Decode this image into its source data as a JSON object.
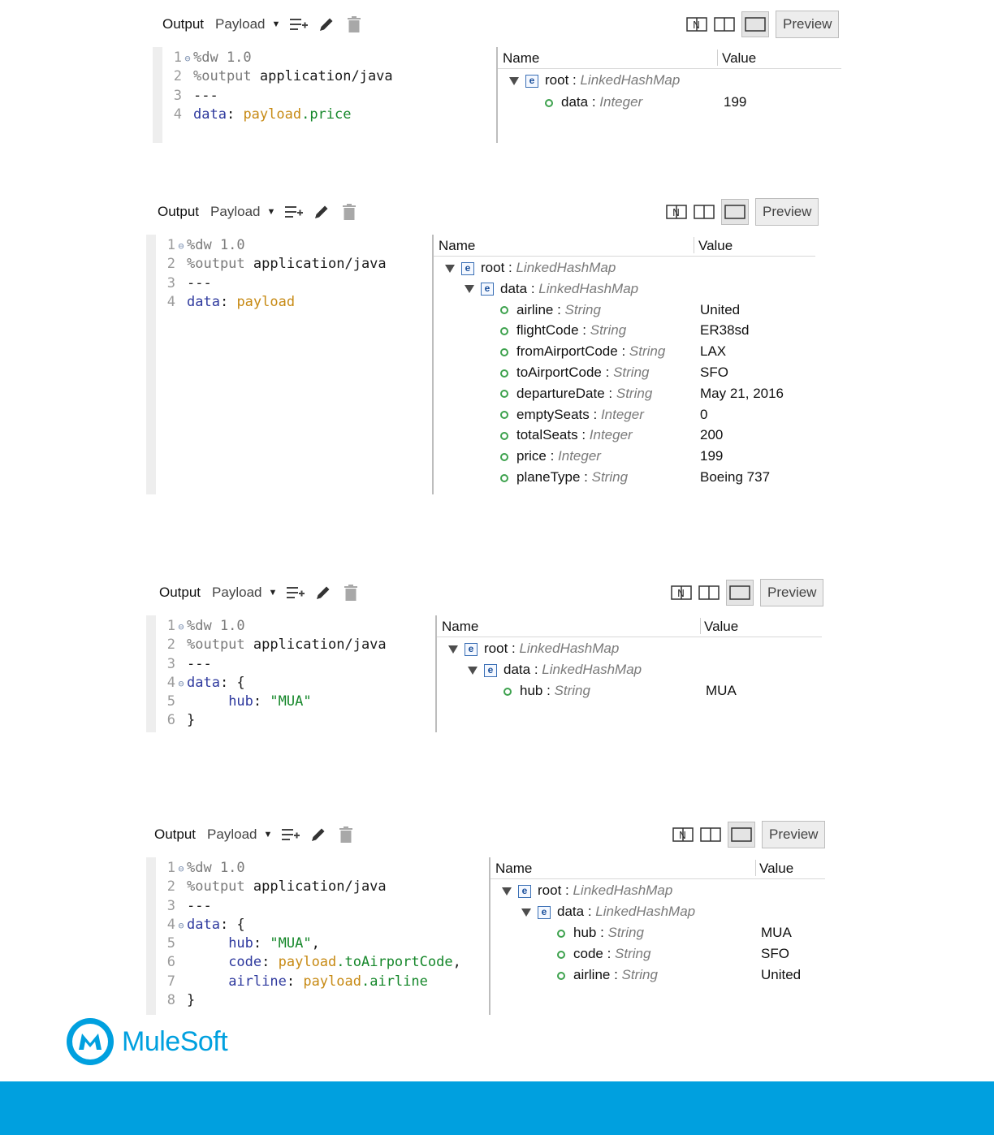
{
  "toolbar": {
    "output_label": "Output",
    "payload_label": "Payload",
    "preview_label": "Preview"
  },
  "panels": [
    {
      "code": [
        {
          "n": "1",
          "fold": true,
          "tokens": [
            [
              "dir",
              "%dw 1.0"
            ]
          ]
        },
        {
          "n": "2",
          "fold": false,
          "tokens": [
            [
              "dir",
              "%output "
            ],
            [
              "kw",
              "application/java"
            ]
          ]
        },
        {
          "n": "3",
          "fold": false,
          "tokens": [
            [
              "kw",
              "---"
            ]
          ]
        },
        {
          "n": "4",
          "fold": false,
          "tokens": [
            [
              "key",
              "data"
            ],
            [
              "punc",
              ": "
            ],
            [
              "pay",
              "payload"
            ],
            [
              "prop",
              ".price"
            ]
          ]
        }
      ],
      "tree_header": {
        "name": "Name",
        "value": "Value"
      },
      "tree": [
        {
          "depth": 0,
          "kind": "e",
          "expanded": true,
          "name": "root",
          "type": "LinkedHashMap",
          "value": ""
        },
        {
          "depth": 1,
          "kind": "leaf",
          "expanded": false,
          "name": "data",
          "type": "Integer",
          "value": "199"
        }
      ]
    },
    {
      "code": [
        {
          "n": "1",
          "fold": true,
          "tokens": [
            [
              "dir",
              "%dw 1.0"
            ]
          ]
        },
        {
          "n": "2",
          "fold": false,
          "tokens": [
            [
              "dir",
              "%output "
            ],
            [
              "kw",
              "application/java"
            ]
          ]
        },
        {
          "n": "3",
          "fold": false,
          "tokens": [
            [
              "kw",
              "---"
            ]
          ]
        },
        {
          "n": "4",
          "fold": false,
          "tokens": [
            [
              "key",
              "data"
            ],
            [
              "punc",
              ": "
            ],
            [
              "pay",
              "payload"
            ]
          ]
        }
      ],
      "tree_header": {
        "name": "Name",
        "value": "Value"
      },
      "tree": [
        {
          "depth": 0,
          "kind": "e",
          "expanded": true,
          "name": "root",
          "type": "LinkedHashMap",
          "value": ""
        },
        {
          "depth": 1,
          "kind": "e",
          "expanded": true,
          "name": "data",
          "type": "LinkedHashMap",
          "value": ""
        },
        {
          "depth": 2,
          "kind": "leaf",
          "expanded": false,
          "name": "airline",
          "type": "String",
          "value": "United"
        },
        {
          "depth": 2,
          "kind": "leaf",
          "expanded": false,
          "name": "flightCode",
          "type": "String",
          "value": "ER38sd"
        },
        {
          "depth": 2,
          "kind": "leaf",
          "expanded": false,
          "name": "fromAirportCode",
          "type": "String",
          "value": "LAX"
        },
        {
          "depth": 2,
          "kind": "leaf",
          "expanded": false,
          "name": "toAirportCode",
          "type": "String",
          "value": "SFO"
        },
        {
          "depth": 2,
          "kind": "leaf",
          "expanded": false,
          "name": "departureDate",
          "type": "String",
          "value": "May 21, 2016"
        },
        {
          "depth": 2,
          "kind": "leaf",
          "expanded": false,
          "name": "emptySeats",
          "type": "Integer",
          "value": "0"
        },
        {
          "depth": 2,
          "kind": "leaf",
          "expanded": false,
          "name": "totalSeats",
          "type": "Integer",
          "value": "200"
        },
        {
          "depth": 2,
          "kind": "leaf",
          "expanded": false,
          "name": "price",
          "type": "Integer",
          "value": "199"
        },
        {
          "depth": 2,
          "kind": "leaf",
          "expanded": false,
          "name": "planeType",
          "type": "String",
          "value": "Boeing 737"
        }
      ]
    },
    {
      "code": [
        {
          "n": "1",
          "fold": true,
          "tokens": [
            [
              "dir",
              "%dw 1.0"
            ]
          ]
        },
        {
          "n": "2",
          "fold": false,
          "tokens": [
            [
              "dir",
              "%output "
            ],
            [
              "kw",
              "application/java"
            ]
          ]
        },
        {
          "n": "3",
          "fold": false,
          "tokens": [
            [
              "kw",
              "---"
            ]
          ]
        },
        {
          "n": "4",
          "fold": true,
          "tokens": [
            [
              "key",
              "data"
            ],
            [
              "punc",
              ": {"
            ]
          ]
        },
        {
          "n": "5",
          "fold": false,
          "tokens": [
            [
              "punc",
              "     "
            ],
            [
              "key",
              "hub"
            ],
            [
              "punc",
              ": "
            ],
            [
              "str",
              "\"MUA\""
            ]
          ]
        },
        {
          "n": "6",
          "fold": false,
          "tokens": [
            [
              "punc",
              "}"
            ]
          ]
        }
      ],
      "tree_header": {
        "name": "Name",
        "value": "Value"
      },
      "tree": [
        {
          "depth": 0,
          "kind": "e",
          "expanded": true,
          "name": "root",
          "type": "LinkedHashMap",
          "value": ""
        },
        {
          "depth": 1,
          "kind": "e",
          "expanded": true,
          "name": "data",
          "type": "LinkedHashMap",
          "value": ""
        },
        {
          "depth": 2,
          "kind": "leaf",
          "expanded": false,
          "name": "hub",
          "type": "String",
          "value": "MUA"
        }
      ]
    },
    {
      "code": [
        {
          "n": "1",
          "fold": true,
          "tokens": [
            [
              "dir",
              "%dw 1.0"
            ]
          ]
        },
        {
          "n": "2",
          "fold": false,
          "tokens": [
            [
              "dir",
              "%output "
            ],
            [
              "kw",
              "application/java"
            ]
          ]
        },
        {
          "n": "3",
          "fold": false,
          "tokens": [
            [
              "kw",
              "---"
            ]
          ]
        },
        {
          "n": "4",
          "fold": true,
          "tokens": [
            [
              "key",
              "data"
            ],
            [
              "punc",
              ": {"
            ]
          ]
        },
        {
          "n": "5",
          "fold": false,
          "tokens": [
            [
              "punc",
              "     "
            ],
            [
              "key",
              "hub"
            ],
            [
              "punc",
              ": "
            ],
            [
              "str",
              "\"MUA\""
            ],
            [
              "punc",
              ","
            ]
          ]
        },
        {
          "n": "6",
          "fold": false,
          "tokens": [
            [
              "punc",
              "     "
            ],
            [
              "key",
              "code"
            ],
            [
              "punc",
              ": "
            ],
            [
              "pay",
              "payload"
            ],
            [
              "prop",
              ".toAirportCode"
            ],
            [
              "punc",
              ","
            ]
          ]
        },
        {
          "n": "7",
          "fold": false,
          "tokens": [
            [
              "punc",
              "     "
            ],
            [
              "key",
              "airline"
            ],
            [
              "punc",
              ": "
            ],
            [
              "pay",
              "payload"
            ],
            [
              "prop",
              ".airline"
            ]
          ]
        },
        {
          "n": "8",
          "fold": false,
          "tokens": [
            [
              "punc",
              "}"
            ]
          ]
        }
      ],
      "tree_header": {
        "name": "Name",
        "value": "Value"
      },
      "tree": [
        {
          "depth": 0,
          "kind": "e",
          "expanded": true,
          "name": "root",
          "type": "LinkedHashMap",
          "value": ""
        },
        {
          "depth": 1,
          "kind": "e",
          "expanded": true,
          "name": "data",
          "type": "LinkedHashMap",
          "value": ""
        },
        {
          "depth": 2,
          "kind": "leaf",
          "expanded": false,
          "name": "hub",
          "type": "String",
          "value": "MUA"
        },
        {
          "depth": 2,
          "kind": "leaf",
          "expanded": false,
          "name": "code",
          "type": "String",
          "value": "SFO"
        },
        {
          "depth": 2,
          "kind": "leaf",
          "expanded": false,
          "name": "airline",
          "type": "String",
          "value": "United"
        }
      ]
    }
  ],
  "logo": {
    "text": "MuleSoft",
    "icon": "mulesoft-logo-icon"
  },
  "colors": {
    "brand": "#00a0df",
    "keyword": "#2f3a9e",
    "payload": "#c78a14",
    "property": "#15872a",
    "leaf_dot": "#3ea24e"
  }
}
